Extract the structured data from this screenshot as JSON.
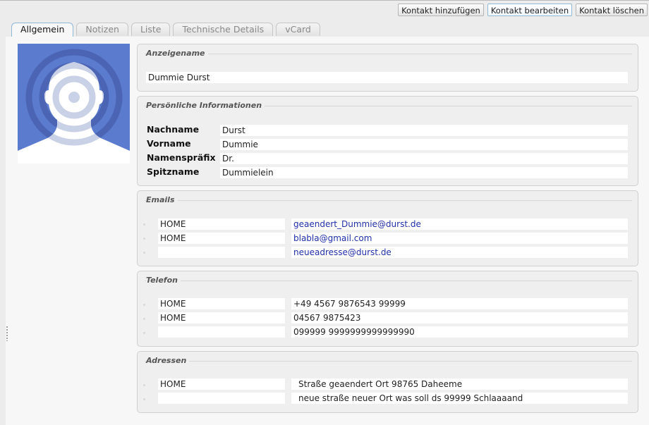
{
  "toolbar": {
    "add_label": "Kontakt hinzufügen",
    "edit_label": "Kontakt bearbeiten",
    "delete_label": "Kontakt löschen"
  },
  "tabs": [
    {
      "label": "Allgemein",
      "active": true
    },
    {
      "label": "Notizen"
    },
    {
      "label": "Liste"
    },
    {
      "label": "Technische Details"
    },
    {
      "label": "vCard"
    }
  ],
  "avatar": {
    "icon": "default-contact-silhouette-icon",
    "bg_color": "#5b7bcf"
  },
  "display_name": {
    "legend": "Anzeigename",
    "value": "Dummie Durst"
  },
  "personal": {
    "legend": "Persönliche Informationen",
    "rows": [
      {
        "label": "Nachname",
        "value": "Durst"
      },
      {
        "label": "Vorname",
        "value": "Dummie"
      },
      {
        "label": "Namenspräfix",
        "value": "Dr."
      },
      {
        "label": "Spitzname",
        "value": "Dummielein"
      }
    ]
  },
  "emails": {
    "legend": "Emails",
    "rows": [
      {
        "type": "HOME",
        "value": "geaendert_Dummie@durst.de"
      },
      {
        "type": "HOME",
        "value": "blabla@gmail.com"
      },
      {
        "type": "",
        "value": "neueadresse@durst.de"
      }
    ]
  },
  "phones": {
    "legend": "Telefon",
    "rows": [
      {
        "type": "HOME",
        "value": "+49 4567 9876543 99999"
      },
      {
        "type": "HOME",
        "value": "04567 9875423"
      },
      {
        "type": "",
        "value": "099999 9999999999999990"
      }
    ]
  },
  "addresses": {
    "legend": "Adressen",
    "rows": [
      {
        "type": "HOME",
        "value": "Straße geaendert Ort  98765 Daheeme"
      },
      {
        "type": "",
        "value": "neue straße neuer Ort was soll ds 99999 Schlaaaand"
      }
    ]
  }
}
